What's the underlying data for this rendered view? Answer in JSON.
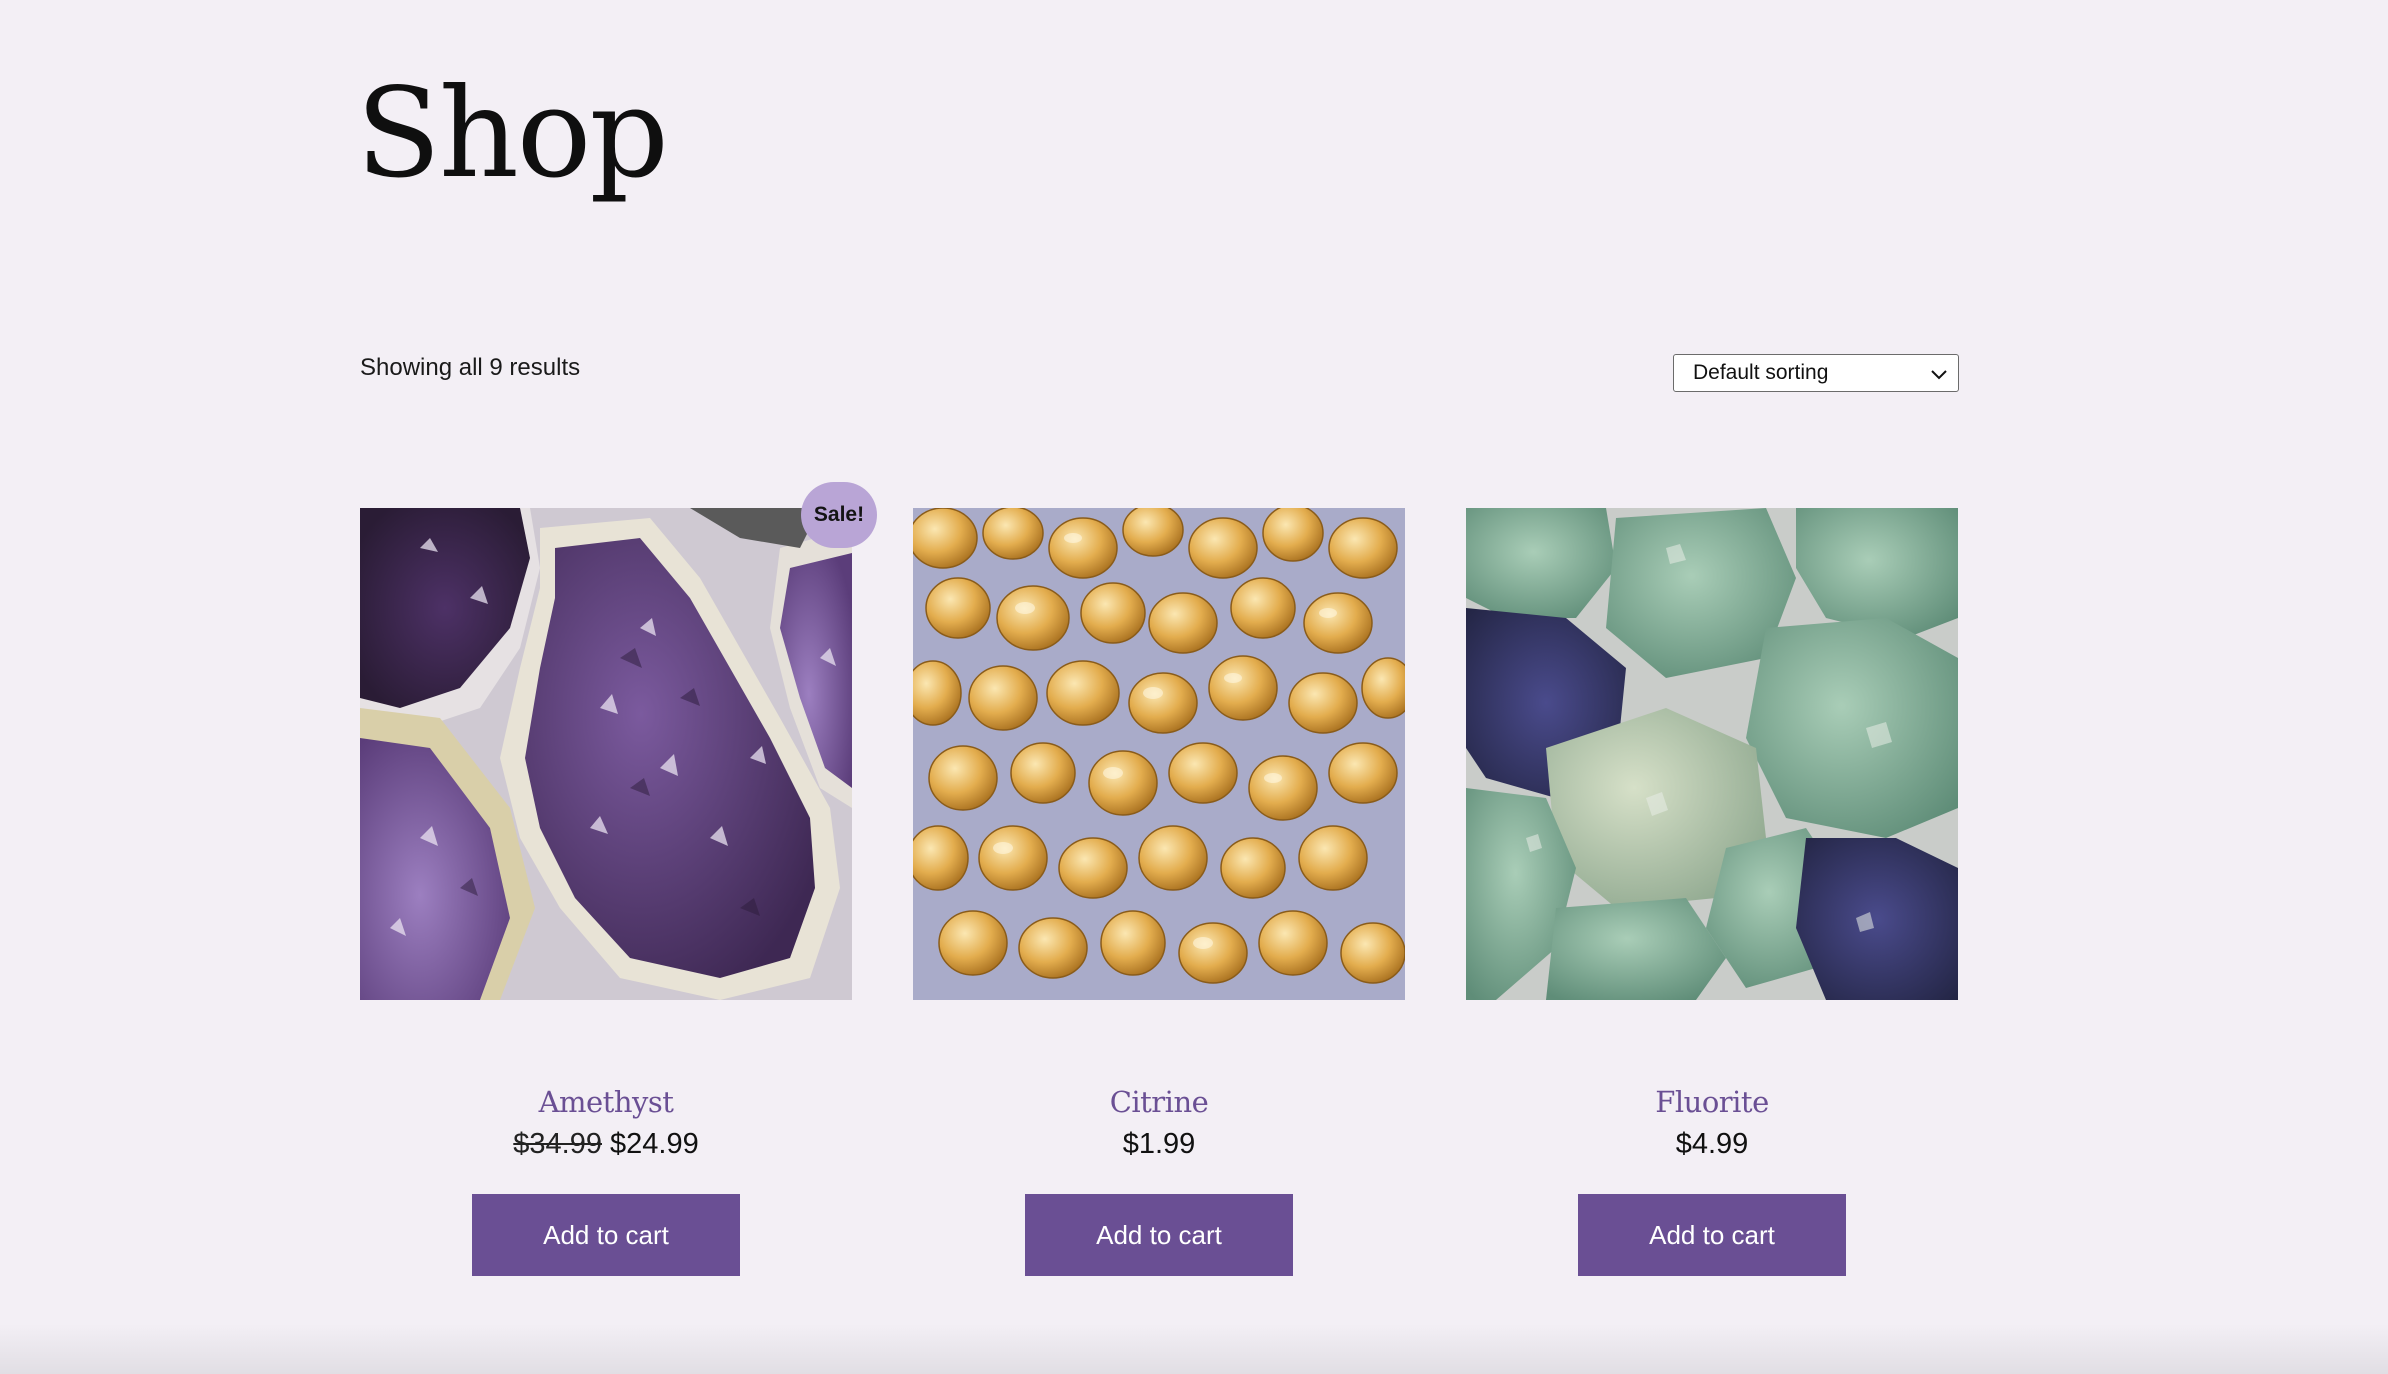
{
  "page": {
    "title": "Shop",
    "result_count": "Showing all 9 results"
  },
  "sorting": {
    "selected": "Default sorting"
  },
  "colors": {
    "background": "#f3eff5",
    "accent": "#6a4f94",
    "sale_badge": "#b9a5d6"
  },
  "products": [
    {
      "name": "Amethyst",
      "regular_price": "$34.99",
      "price": "$24.99",
      "on_sale": true,
      "sale_badge": "Sale!",
      "button": "Add to cart",
      "image_icon": "amethyst-crystals-image"
    },
    {
      "name": "Citrine",
      "price": "$1.99",
      "on_sale": false,
      "button": "Add to cart",
      "image_icon": "citrine-stones-image"
    },
    {
      "name": "Fluorite",
      "price": "$4.99",
      "on_sale": false,
      "button": "Add to cart",
      "image_icon": "fluorite-rocks-image"
    }
  ]
}
